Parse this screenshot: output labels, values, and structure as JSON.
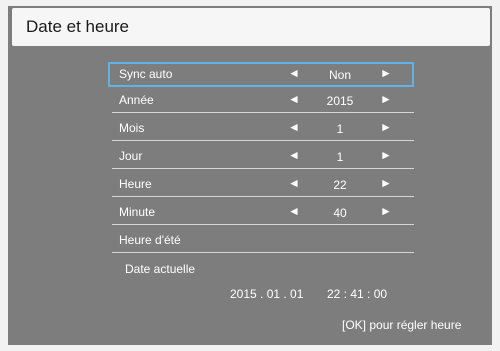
{
  "window": {
    "title": "Date et heure"
  },
  "rows": [
    {
      "label": "Sync auto",
      "value": "Non",
      "selected": true
    },
    {
      "label": "Année",
      "value": "2015"
    },
    {
      "label": "Mois",
      "value": "1"
    },
    {
      "label": "Jour",
      "value": "1"
    },
    {
      "label": "Heure",
      "value": "22"
    },
    {
      "label": "Minute",
      "value": "40"
    },
    {
      "label": "Heure d'été"
    }
  ],
  "arrows": {
    "left": "◄",
    "right": "►"
  },
  "current": {
    "label": "Date actuelle",
    "date": "2015 . 01 . 01",
    "time": "22 : 41 : 00"
  },
  "hint": "[OK] pour régler heure",
  "colors": {
    "background": "#7d7d7d",
    "title_bar": "#f6f6f6",
    "highlight": "#5eb2e8",
    "text": "#ffffff"
  }
}
